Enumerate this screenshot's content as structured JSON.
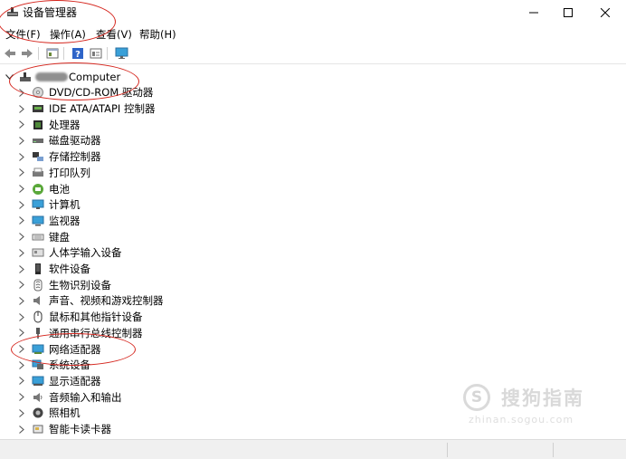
{
  "window": {
    "title": "设备管理器"
  },
  "menu": [
    "文件(F)",
    "操作(A)",
    "查看(V)",
    "帮助(H)"
  ],
  "tree": {
    "root_label": "Computer",
    "nodes": [
      {
        "label": "DVD/CD-ROM 驱动器",
        "icon": "dvd-drive-icon"
      },
      {
        "label": "IDE ATA/ATAPI 控制器",
        "icon": "ide-controller-icon"
      },
      {
        "label": "处理器",
        "icon": "processor-icon"
      },
      {
        "label": "磁盘驱动器",
        "icon": "disk-drive-icon"
      },
      {
        "label": "存储控制器",
        "icon": "storage-controller-icon"
      },
      {
        "label": "打印队列",
        "icon": "printer-icon"
      },
      {
        "label": "电池",
        "icon": "battery-icon"
      },
      {
        "label": "计算机",
        "icon": "computer-icon"
      },
      {
        "label": "监视器",
        "icon": "monitor-icon"
      },
      {
        "label": "键盘",
        "icon": "keyboard-icon"
      },
      {
        "label": "人体学输入设备",
        "icon": "hid-icon"
      },
      {
        "label": "软件设备",
        "icon": "software-device-icon"
      },
      {
        "label": "生物识别设备",
        "icon": "biometric-icon"
      },
      {
        "label": "声音、视频和游戏控制器",
        "icon": "speaker-icon"
      },
      {
        "label": "鼠标和其他指针设备",
        "icon": "mouse-icon"
      },
      {
        "label": "通用串行总线控制器",
        "icon": "usb-icon"
      },
      {
        "label": "网络适配器",
        "icon": "network-adapter-icon"
      },
      {
        "label": "系统设备",
        "icon": "system-device-icon"
      },
      {
        "label": "显示适配器",
        "icon": "display-adapter-icon"
      },
      {
        "label": "音频输入和输出",
        "icon": "audio-io-icon"
      },
      {
        "label": "照相机",
        "icon": "camera-icon"
      },
      {
        "label": "智能卡读卡器",
        "icon": "smart-card-reader-icon"
      }
    ]
  },
  "watermark": {
    "main": "搜狗指南",
    "sub": "zhinan.sogou.com",
    "logo": "S"
  },
  "colors": {
    "annotation": "#d5271f",
    "status_bar": "#f0f0f0"
  }
}
